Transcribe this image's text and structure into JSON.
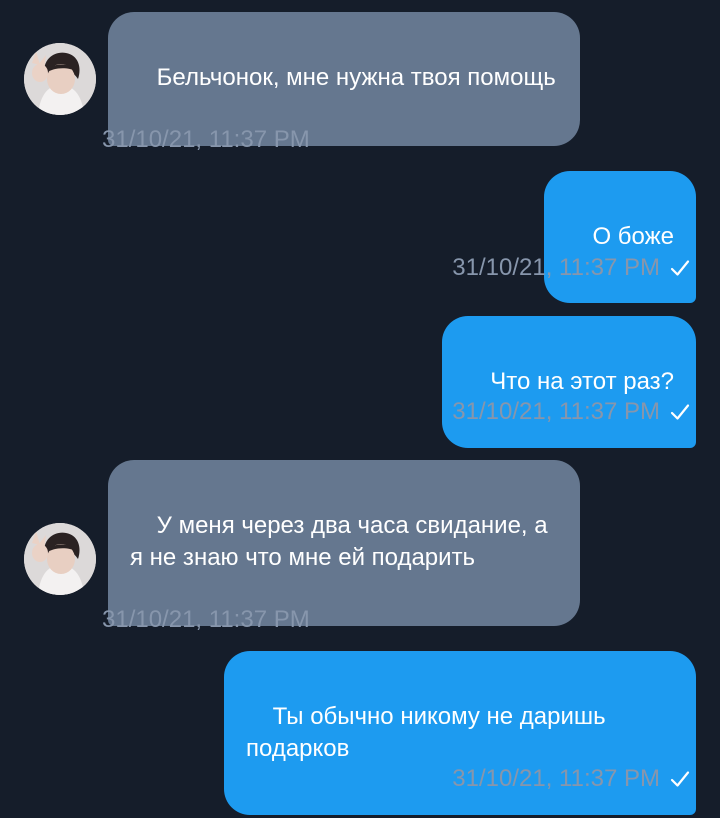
{
  "conversation": {
    "messages": [
      {
        "direction": "in",
        "text": "Бельчонок, мне нужна твоя помощь",
        "time": "31/10/21, 11:37 PM",
        "avatar": "user-avatar"
      },
      {
        "direction": "out",
        "text": "О боже",
        "time": "31/10/21, 11:37 PM",
        "status_icon": "sent-check-icon"
      },
      {
        "direction": "out",
        "text": "Что на этот раз?",
        "time": "31/10/21, 11:37 PM",
        "status_icon": "sent-check-icon"
      },
      {
        "direction": "in",
        "text": "У меня через два часа свидание, а я не знаю что мне ей подарить",
        "time": "31/10/21, 11:37 PM",
        "avatar": "user-avatar"
      },
      {
        "direction": "out",
        "text": "Ты обычно никому не даришь подарков",
        "time": "31/10/21, 11:37 PM",
        "status_icon": "sent-check-icon"
      }
    ]
  },
  "colors": {
    "background": "#151d2a",
    "incoming_bubble": "#65778f",
    "outgoing_bubble": "#1d9bf0",
    "timestamp": "#8796ac",
    "text": "#ffffff"
  }
}
